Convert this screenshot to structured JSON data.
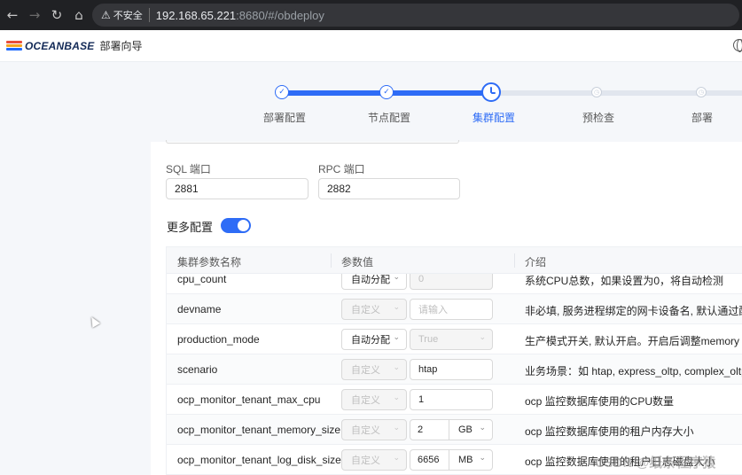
{
  "browser": {
    "back_icon": "arrow-left-icon",
    "forward_icon": "arrow-right-icon",
    "reload_icon": "reload-icon",
    "home_icon": "home-icon",
    "security_text": "不安全",
    "url_host": "192.168.65.221",
    "url_rest": ":8680/#/obdeploy"
  },
  "app": {
    "logo_text": "OCEANBASE",
    "title": "部署向导",
    "brand_colors": [
      "#e84e3c",
      "#f5a623",
      "#1f6bff"
    ]
  },
  "steps": [
    {
      "label": "部署配置",
      "status": "done"
    },
    {
      "label": "节点配置",
      "status": "done"
    },
    {
      "label": "集群配置",
      "status": "current"
    },
    {
      "label": "预检查",
      "status": "pending"
    },
    {
      "label": "部署",
      "status": "pending"
    }
  ],
  "form": {
    "sql_port_label": "SQL 端口",
    "sql_port_value": "2881",
    "rpc_port_label": "RPC 端口",
    "rpc_port_value": "2882",
    "more_config_label": "更多配置",
    "more_config_enabled": true
  },
  "table": {
    "headers": [
      "集群参数名称",
      "参数值",
      "介绍"
    ],
    "rows": [
      {
        "name": "cpu_count",
        "mode": "自动分配",
        "mode_disabled": false,
        "value": "0",
        "value_kind": "disabled",
        "unit": "",
        "desc": "系统CPU总数，如果设置为0，将自动检测"
      },
      {
        "name": "devname",
        "mode": "自定义",
        "mode_disabled": true,
        "value": "请输入",
        "value_kind": "placeholder",
        "unit": "",
        "desc": "非必填, 服务进程绑定的网卡设备名, 默认通过配置的ip"
      },
      {
        "name": "production_mode",
        "mode": "自动分配",
        "mode_disabled": false,
        "value": "True",
        "value_kind": "disabled-select",
        "unit": "",
        "desc": "生产模式开关, 默认开启。开启后调整memory limit 和"
      },
      {
        "name": "scenario",
        "mode": "自定义",
        "mode_disabled": true,
        "value": "htap",
        "value_kind": "text",
        "unit": "",
        "desc": "业务场景：如 htap, express_oltp, complex_oltp, olap,"
      },
      {
        "name": "ocp_monitor_tenant_max_cpu",
        "mode": "自定义",
        "mode_disabled": true,
        "value": "1",
        "value_kind": "text",
        "unit": "",
        "desc": "ocp 监控数据库使用的CPU数量"
      },
      {
        "name": "ocp_monitor_tenant_memory_size",
        "mode": "自定义",
        "mode_disabled": true,
        "value": "2",
        "value_kind": "unit",
        "unit": "GB",
        "desc": "ocp 监控数据库使用的租户内存大小"
      },
      {
        "name": "ocp_monitor_tenant_log_disk_size",
        "mode": "自定义",
        "mode_disabled": true,
        "value": "6656",
        "value_kind": "unit",
        "unit": "MB",
        "desc": "ocp 监控数据库使用的租户日志磁盘大小"
      }
    ]
  },
  "watermark": "CSDN @纸条程序猿",
  "accent_color": "#2e6cf6"
}
